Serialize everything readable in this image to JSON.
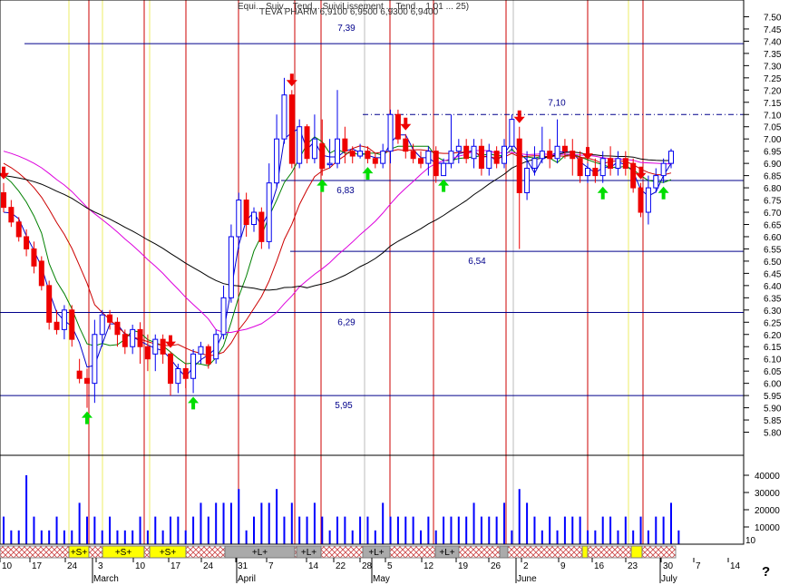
{
  "header": {
    "line1": "Equi... Suiv... Tend... SuiviLissement ... Tend... 1,01 ... 25)",
    "line2": "TEVA PHARM 6,9100 6,9500 6,9300 6,9400"
  },
  "question_mark": "?",
  "volume_box_label": "10",
  "colors": {
    "blue_line": "#00008b",
    "red_line": "#dd0000",
    "bull_candle": "#0000ee",
    "bear_candle": "#ee0000",
    "sma_blue": "#0000cc",
    "sma_green": "#008000",
    "sma_red": "#cc0000",
    "sma_magenta": "#dd00dd",
    "sma_black": "#000000",
    "arrow_down": "#ee0000",
    "arrow_up": "#00dd00",
    "vline_red": "#cc0000",
    "vline_yellow": "#eeee66",
    "vline_gray": "#bbbbbb",
    "volume_bar": "#0000ff",
    "strip_hatch": "#cc4444",
    "strip_yellow": "#ffff00",
    "strip_gray": "#aaaaaa"
  },
  "chart_data": {
    "type": "candlestick",
    "title": "",
    "price_axis": {
      "min": 5.75,
      "max": 7.55,
      "ticks": [
        "5.80",
        "5.85",
        "5.90",
        "5.95",
        "6.00",
        "6.05",
        "6.10",
        "6.15",
        "6.20",
        "6.25",
        "6.30",
        "6.35",
        "6.40",
        "6.45",
        "6.50",
        "6.55",
        "6.60",
        "6.65",
        "6.70",
        "6.75",
        "6.80",
        "6.85",
        "6.90",
        "6.95",
        "7.00",
        "7.05",
        "7.10",
        "7.15",
        "7.20",
        "7.25",
        "7.30",
        "7.35",
        "7.40",
        "7.45",
        "7.50"
      ]
    },
    "volume_axis": {
      "min": 0,
      "max": 50000,
      "ticks": [
        "10000",
        "20000",
        "30000",
        "40000"
      ]
    },
    "date_ticks": [
      "10",
      "17",
      "24",
      "3",
      "10",
      "17",
      "24",
      "31",
      "7",
      "14",
      "22",
      "28",
      "5",
      "12",
      "19",
      "26",
      "2",
      "9",
      "16",
      "23",
      "30",
      "7",
      "14"
    ],
    "month_labels": [
      "March",
      "April",
      "May",
      "June",
      "July"
    ],
    "horizontal_levels": [
      {
        "value": 7.39,
        "label": "7,39",
        "style": "solid"
      },
      {
        "value": 7.1,
        "label": "7,10",
        "style": "dashdot"
      },
      {
        "value": 6.83,
        "label": "6,83",
        "style": "solid"
      },
      {
        "value": 6.54,
        "label": "6,54",
        "style": "solid"
      },
      {
        "value": 6.29,
        "label": "6,29",
        "style": "solid"
      },
      {
        "value": 5.95,
        "label": "5,95",
        "style": "solid"
      }
    ],
    "signal_strip": [
      {
        "label": "+S+",
        "kind": "yellow"
      },
      {
        "label": "+S+",
        "kind": "yellow"
      },
      {
        "label": "+S+",
        "kind": "yellow"
      },
      {
        "label": "+L+",
        "kind": "gray"
      },
      {
        "label": "+L+",
        "kind": "gray"
      },
      {
        "label": "+L+",
        "kind": "gray"
      },
      {
        "label": "+L+",
        "kind": "gray"
      }
    ],
    "candles": [
      [
        6.78,
        6.72,
        6.82,
        6.7
      ],
      [
        6.72,
        6.66,
        6.75,
        6.64
      ],
      [
        6.66,
        6.6,
        6.68,
        6.58
      ],
      [
        6.6,
        6.55,
        6.63,
        6.52
      ],
      [
        6.55,
        6.48,
        6.58,
        6.45
      ],
      [
        6.5,
        6.4,
        6.52,
        6.38
      ],
      [
        6.4,
        6.25,
        6.42,
        6.22
      ],
      [
        6.25,
        6.22,
        6.3,
        6.2
      ],
      [
        6.22,
        6.3,
        6.32,
        6.18
      ],
      [
        6.3,
        6.18,
        6.32,
        6.15
      ],
      [
        6.05,
        6.02,
        6.1,
        6.0
      ],
      [
        6.02,
        6.0,
        6.06,
        5.9
      ],
      [
        6.0,
        6.2,
        6.26,
        5.92
      ],
      [
        6.2,
        6.28,
        6.3,
        6.15
      ],
      [
        6.28,
        6.25,
        6.3,
        6.22
      ],
      [
        6.25,
        6.2,
        6.27,
        6.15
      ],
      [
        6.2,
        6.15,
        6.22,
        6.12
      ],
      [
        6.15,
        6.22,
        6.24,
        6.12
      ],
      [
        6.22,
        6.15,
        6.25,
        6.08
      ],
      [
        6.15,
        6.1,
        6.2,
        6.05
      ],
      [
        6.12,
        6.18,
        6.2,
        6.05
      ],
      [
        6.18,
        6.12,
        6.2,
        6.08
      ],
      [
        6.12,
        6.0,
        6.13,
        5.95
      ],
      [
        6.0,
        6.06,
        6.08,
        5.96
      ],
      [
        6.06,
        6.02,
        6.08,
        5.98
      ],
      [
        6.02,
        6.12,
        6.14,
        5.96
      ],
      [
        6.12,
        6.15,
        6.17,
        6.08
      ],
      [
        6.15,
        6.08,
        6.16,
        6.06
      ],
      [
        6.1,
        6.2,
        6.22,
        6.08
      ],
      [
        6.2,
        6.35,
        6.4,
        6.18
      ],
      [
        6.35,
        6.6,
        6.65,
        6.33
      ],
      [
        6.6,
        6.75,
        6.78,
        6.55
      ],
      [
        6.75,
        6.65,
        6.78,
        6.6
      ],
      [
        6.65,
        6.7,
        6.72,
        6.62
      ],
      [
        6.7,
        6.58,
        6.72,
        6.55
      ],
      [
        6.58,
        6.82,
        6.9,
        6.55
      ],
      [
        6.82,
        7.0,
        7.1,
        6.8
      ],
      [
        7.0,
        7.18,
        7.25,
        6.98
      ],
      [
        7.18,
        6.9,
        7.2,
        6.88
      ],
      [
        6.9,
        7.05,
        7.08,
        6.88
      ],
      [
        7.05,
        6.92,
        7.06,
        6.9
      ],
      [
        6.92,
        7.0,
        7.1,
        6.9
      ],
      [
        6.98,
        6.88,
        7.08,
        6.85
      ],
      [
        6.9,
        6.9,
        7.0,
        6.88
      ],
      [
        6.9,
        7.0,
        7.2,
        6.88
      ],
      [
        7.0,
        6.95,
        7.05,
        6.9
      ],
      [
        6.95,
        6.93,
        6.97,
        6.9
      ],
      [
        6.93,
        6.95,
        6.98,
        6.92
      ],
      [
        6.95,
        6.92,
        6.97,
        6.9
      ],
      [
        6.92,
        6.9,
        6.94,
        6.88
      ],
      [
        6.9,
        6.95,
        6.98,
        6.88
      ],
      [
        6.95,
        7.1,
        7.12,
        6.9
      ],
      [
        7.1,
        7.0,
        7.12,
        6.98
      ],
      [
        7.0,
        6.95,
        7.02,
        6.92
      ],
      [
        6.95,
        6.92,
        6.98,
        6.9
      ],
      [
        6.92,
        6.9,
        6.95,
        6.88
      ],
      [
        6.9,
        6.95,
        6.97,
        6.85
      ],
      [
        6.95,
        6.85,
        6.97,
        6.82
      ],
      [
        6.85,
        6.9,
        6.92,
        6.85
      ],
      [
        6.9,
        6.95,
        7.1,
        6.88
      ],
      [
        6.95,
        6.97,
        7.0,
        6.9
      ],
      [
        6.97,
        6.92,
        7.0,
        6.9
      ],
      [
        6.92,
        6.97,
        7.0,
        6.88
      ],
      [
        6.97,
        6.88,
        7.0,
        6.85
      ],
      [
        6.88,
        6.95,
        6.98,
        6.85
      ],
      [
        6.95,
        6.9,
        6.97,
        6.88
      ],
      [
        6.9,
        6.97,
        7.0,
        6.88
      ],
      [
        6.97,
        7.08,
        7.1,
        6.95
      ],
      [
        7.0,
        6.78,
        7.05,
        6.55
      ],
      [
        6.78,
        6.88,
        6.95,
        6.75
      ],
      [
        6.88,
        6.92,
        6.97,
        6.85
      ],
      [
        6.92,
        6.95,
        7.05,
        6.9
      ],
      [
        6.95,
        6.92,
        7.0,
        6.88
      ],
      [
        6.92,
        6.97,
        7.08,
        6.9
      ],
      [
        6.97,
        6.95,
        7.0,
        6.92
      ],
      [
        6.95,
        6.92,
        7.0,
        6.85
      ],
      [
        6.92,
        6.85,
        6.95,
        6.82
      ],
      [
        6.85,
        6.88,
        6.9,
        6.82
      ],
      [
        6.88,
        6.85,
        6.92,
        6.82
      ],
      [
        6.85,
        6.92,
        6.95,
        6.82
      ],
      [
        6.92,
        6.88,
        6.97,
        6.85
      ],
      [
        6.88,
        6.92,
        6.95,
        6.85
      ],
      [
        6.92,
        6.88,
        6.95,
        6.85
      ],
      [
        6.9,
        6.8,
        6.92,
        6.78
      ],
      [
        6.8,
        6.7,
        6.82,
        6.68
      ],
      [
        6.7,
        6.8,
        6.85,
        6.65
      ],
      [
        6.8,
        6.85,
        6.88,
        6.78
      ],
      [
        6.85,
        6.9,
        6.92,
        6.82
      ],
      [
        6.9,
        6.95,
        6.96,
        6.88
      ]
    ],
    "volume": [
      2,
      1,
      1,
      5,
      2,
      1,
      1,
      2,
      1,
      1,
      3,
      2,
      2,
      1,
      2,
      1,
      1,
      1,
      2,
      1,
      2,
      1,
      2,
      2,
      1,
      2,
      3,
      2,
      3,
      3,
      3,
      4,
      1,
      2,
      3,
      3,
      4,
      2,
      3,
      2,
      2,
      3,
      2,
      1,
      2,
      2,
      1,
      2,
      2,
      1,
      3,
      2,
      2,
      2,
      2,
      1,
      2,
      1,
      2,
      2,
      2,
      2,
      3,
      2,
      2,
      2,
      3,
      1,
      4,
      3,
      2,
      1,
      2,
      1,
      2,
      2,
      2,
      1,
      1,
      2,
      2,
      1,
      2,
      1,
      2,
      1,
      2,
      2,
      3,
      1
    ]
  }
}
